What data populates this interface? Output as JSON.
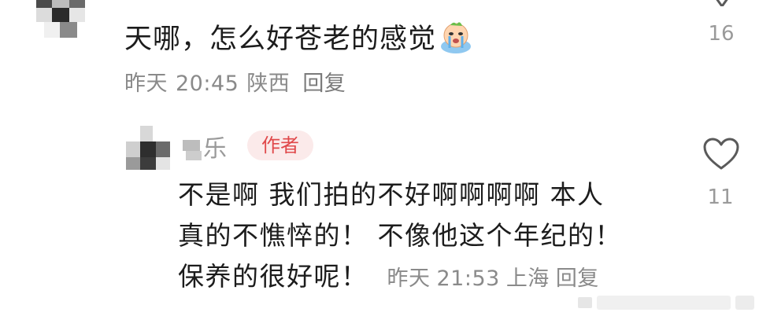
{
  "comment": {
    "text": "天哪，怎么好苍老的感觉",
    "emoji": "crying-face-emoji",
    "date": "昨天",
    "time": "20:45",
    "location": "陕西",
    "reply_label": "回复",
    "likes": "16"
  },
  "reply": {
    "author_name_visible": "乐",
    "author_badge": "作者",
    "lines": [
      "不是啊 我们拍的不好啊啊啊啊 本人",
      "真的不憔悴的！ 不像他这个年纪的！",
      "保养的很好呢！"
    ],
    "date": "昨天",
    "time": "21:53",
    "location": "上海",
    "reply_label": "回复",
    "likes": "11"
  },
  "colors": {
    "text_primary": "#1c1c1c",
    "text_meta": "#8a8a8a",
    "badge_bg": "#fbeaea",
    "badge_text": "#e0484a",
    "icon_gray": "#5a5a5a"
  }
}
